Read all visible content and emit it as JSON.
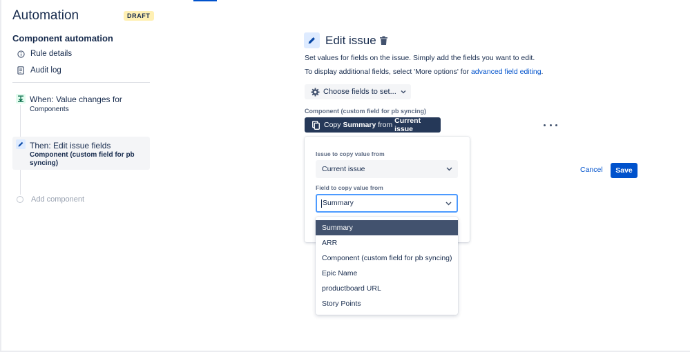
{
  "app": {
    "title": "Automation",
    "badge": "DRAFT"
  },
  "sidebar": {
    "section_title": "Component automation",
    "nav": [
      {
        "label": "Rule details",
        "icon": "info-icon"
      },
      {
        "label": "Audit log",
        "icon": "document-icon"
      }
    ],
    "steps": [
      {
        "title": "When: Value changes for",
        "subtitle": "Components",
        "icon": "trigger-icon"
      },
      {
        "title": "Then: Edit issue fields",
        "subtitle": "Component (custom field for pb syncing)",
        "icon": "pencil-icon"
      }
    ],
    "add_component": "Add component"
  },
  "main": {
    "title": "Edit issue",
    "desc1": "Set values for fields on the issue. Simply add the fields you want to edit.",
    "desc2_prefix": "To display additional fields, select 'More options' for ",
    "desc2_link": "advanced field editing",
    "desc2_suffix": ".",
    "choose_fields": "Choose fields to set...",
    "field_label": "Component (custom field for pb syncing)",
    "copy_button": {
      "prefix": "Copy ",
      "field": "Summary",
      "middle": " from ",
      "source": "Current issue"
    },
    "popup": {
      "issue_label": "Issue to copy value from",
      "issue_value": "Current issue",
      "field_label": "Field to copy value from",
      "field_value": "Summary"
    },
    "cancel": "Cancel",
    "save": "Save"
  },
  "dropdown": {
    "options": [
      "Summary",
      "ARR",
      "Component (custom field for pb syncing)",
      "Epic Name",
      "productboard URL",
      "Story Points"
    ],
    "selected": "Summary"
  },
  "colors": {
    "primary": "#0052cc",
    "dark": "#253858",
    "selected_option": "#42526e",
    "draft_badge": "#fff0b3",
    "focus_border": "#4c9aff"
  }
}
